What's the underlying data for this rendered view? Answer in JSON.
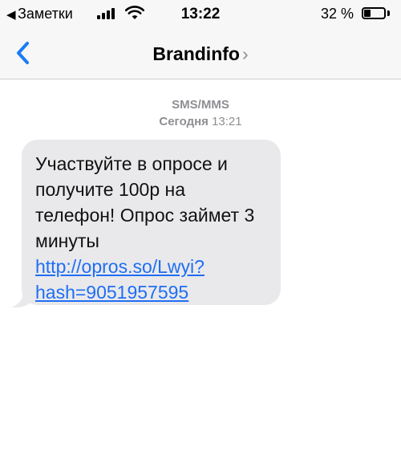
{
  "status_bar": {
    "back_app": "Заметки",
    "time": "13:22",
    "battery_percent": "32 %",
    "battery_level": 0.32,
    "icons": [
      "back-arrow-icon",
      "signal-bars-icon",
      "wifi-icon",
      "battery-icon"
    ]
  },
  "nav": {
    "title": "Brandinfo",
    "title_chevron": "›",
    "back_icon": "chevron-left-icon",
    "accent_color": "#1a7cf5"
  },
  "conversation": {
    "message_type": "SMS/MMS",
    "date_label": "Сегодня",
    "date_time": "13:21"
  },
  "message": {
    "text": "Участвуйте в опросе и получите 100р на телефон! Опрос займет 3 минуты ",
    "link": "http://opros.so/Lwyi?hash=9051957595",
    "bubble_color": "#e9e9eb",
    "link_color": "#1f6ef5"
  }
}
